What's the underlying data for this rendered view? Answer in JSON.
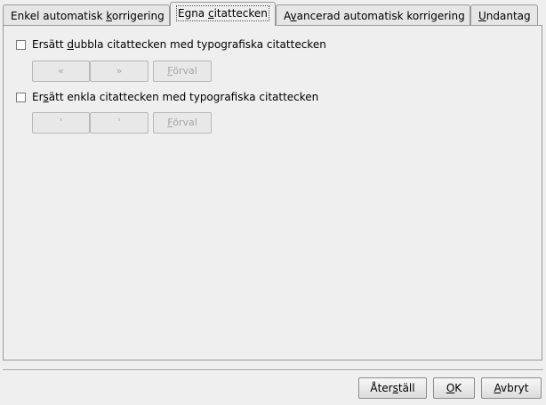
{
  "tabs": [
    {
      "pre": "Enkel automatisk ",
      "acc": "k",
      "post": "orrigering"
    },
    {
      "pre": "Egna ",
      "acc": "c",
      "post": "itattecken"
    },
    {
      "pre": "A",
      "acc": "v",
      "post": "ancerad automatisk korrigering"
    },
    {
      "pre": "",
      "acc": "U",
      "post": "ndantag"
    }
  ],
  "active_tab": 1,
  "double_quotes": {
    "checked": false,
    "label_pre": "Ersätt ",
    "label_acc": "d",
    "label_post": "ubbla citattecken med typografiska citattecken",
    "open_btn": "«",
    "close_btn": "»",
    "default_btn": {
      "acc": "F",
      "post": "örval"
    }
  },
  "single_quotes": {
    "checked": false,
    "label_pre": "Er",
    "label_acc": "s",
    "label_post": "ätt enkla citattecken med typografiska citattecken",
    "open_btn": "'",
    "close_btn": "'",
    "default_btn": {
      "acc": "F",
      "post": "örval"
    }
  },
  "dialog_buttons": {
    "reset": {
      "pre": "Åter",
      "acc": "s",
      "post": "täll"
    },
    "ok": {
      "pre": "",
      "acc": "O",
      "post": "K"
    },
    "cancel": {
      "pre": "",
      "acc": "A",
      "post": "vbryt"
    }
  }
}
